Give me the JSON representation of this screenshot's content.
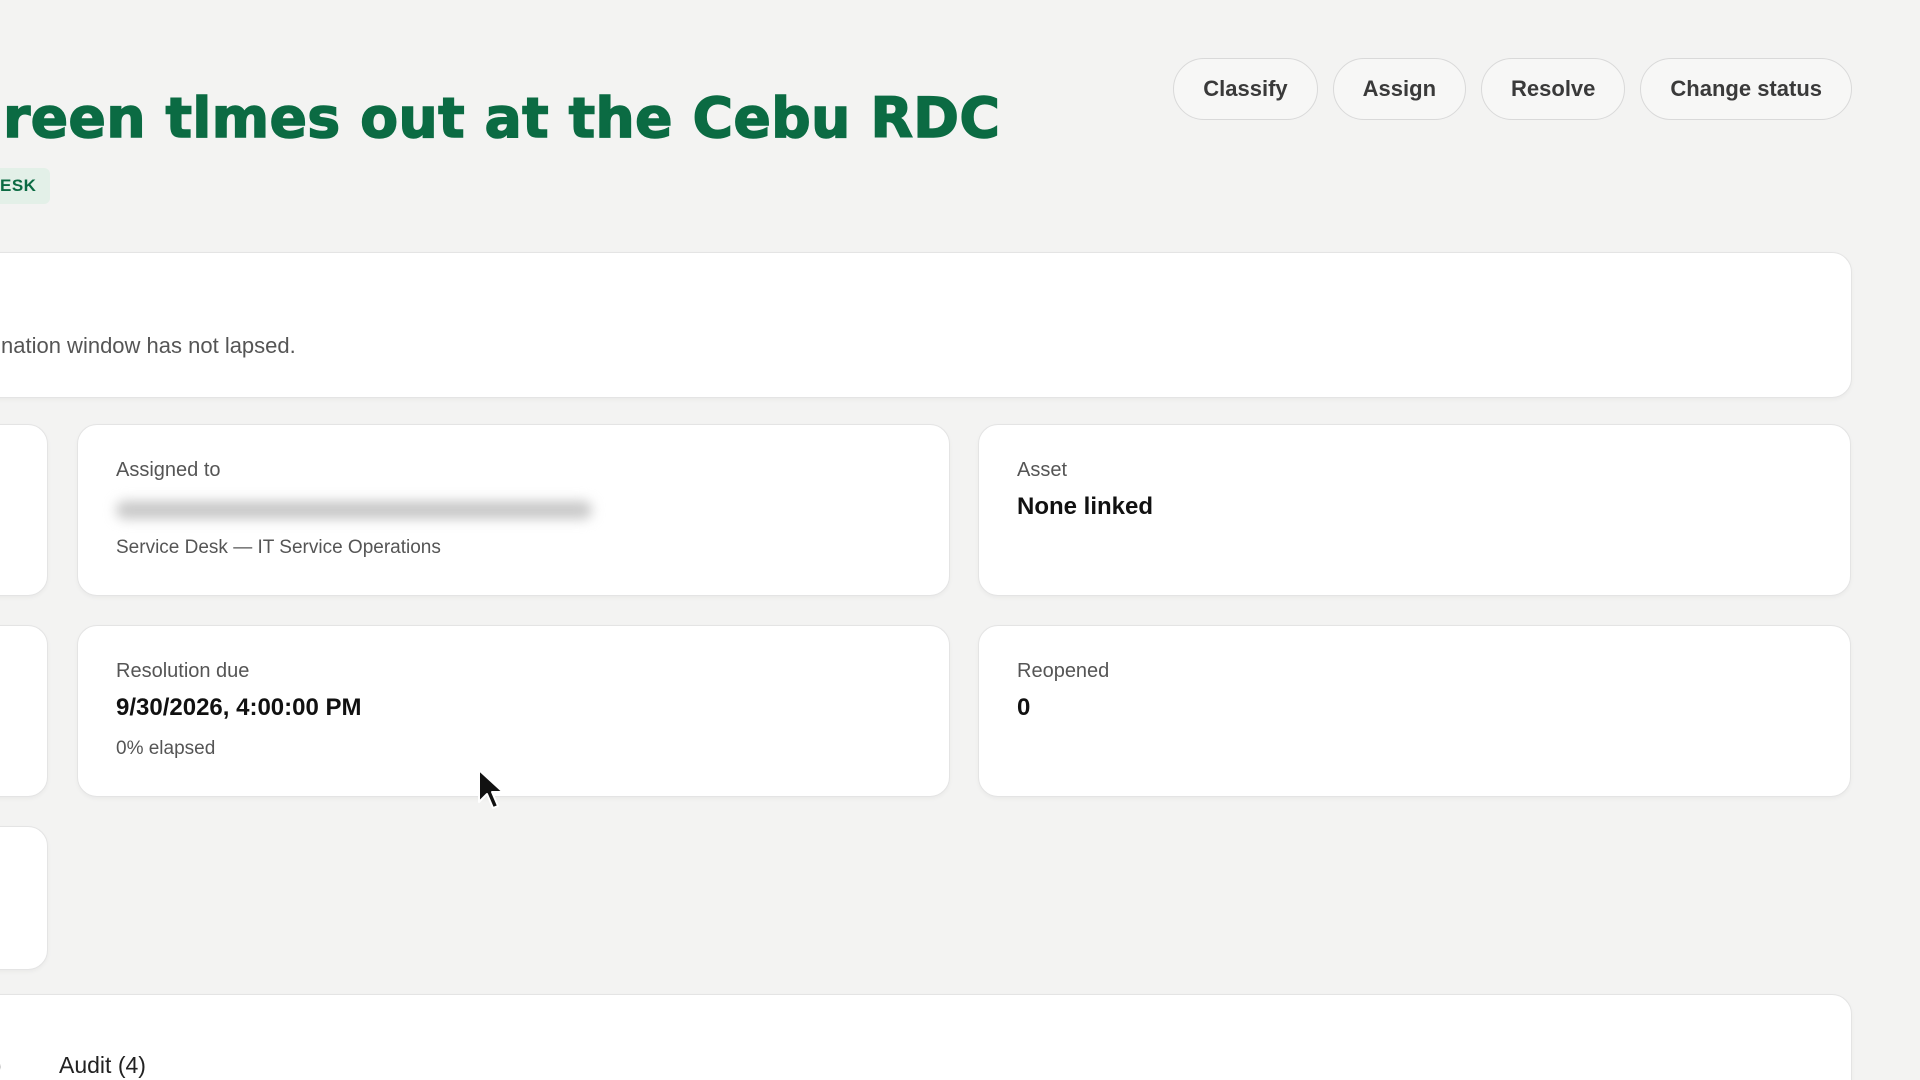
{
  "header": {
    "title": "creen tlmes out at the Cebu RDC",
    "tag": "ESK"
  },
  "actions": {
    "classify": "Classify",
    "assign": "Assign",
    "resolve": "Resolve",
    "change_status": "Change status"
  },
  "banner": {
    "text": "nation window has not lapsed."
  },
  "cards": {
    "assigned": {
      "label": "Assigned to",
      "sub": "Service Desk — IT Service Operations"
    },
    "asset": {
      "label": "Asset",
      "value": "None linked"
    },
    "resolution": {
      "label": "Resolution due",
      "value": "9/30/2026, 4:00:00 PM",
      "sub": "0% elapsed"
    },
    "reopened": {
      "label": "Reopened",
      "value": "0"
    }
  },
  "tabs": {
    "partial": ")",
    "audit": "Audit (4)"
  },
  "colors": {
    "accent": "#0b6b43",
    "tag_bg": "#e3f0e8",
    "background": "#f3f3f2"
  }
}
